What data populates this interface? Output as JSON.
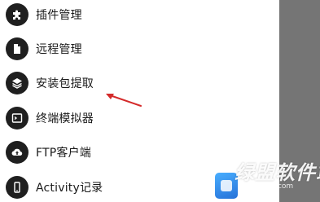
{
  "menu": {
    "items": [
      {
        "label": "插件管理",
        "icon": "puzzle-icon"
      },
      {
        "label": "远程管理",
        "icon": "document-icon"
      },
      {
        "label": "安装包提取",
        "icon": "layers-icon"
      },
      {
        "label": "终端模拟器",
        "icon": "terminal-icon"
      },
      {
        "label": "FTP客户端",
        "icon": "cloud-icon"
      },
      {
        "label": "Activity记录",
        "icon": "phone-icon"
      }
    ]
  },
  "annotation": {
    "arrow_color": "#d42a2a"
  },
  "watermark": {
    "text": "绿盟软件站",
    "url": "www.xxx.com"
  },
  "colors": {
    "icon_background": "#1f1f1f",
    "scrim": "#757575",
    "text": "#1a1a1a"
  }
}
